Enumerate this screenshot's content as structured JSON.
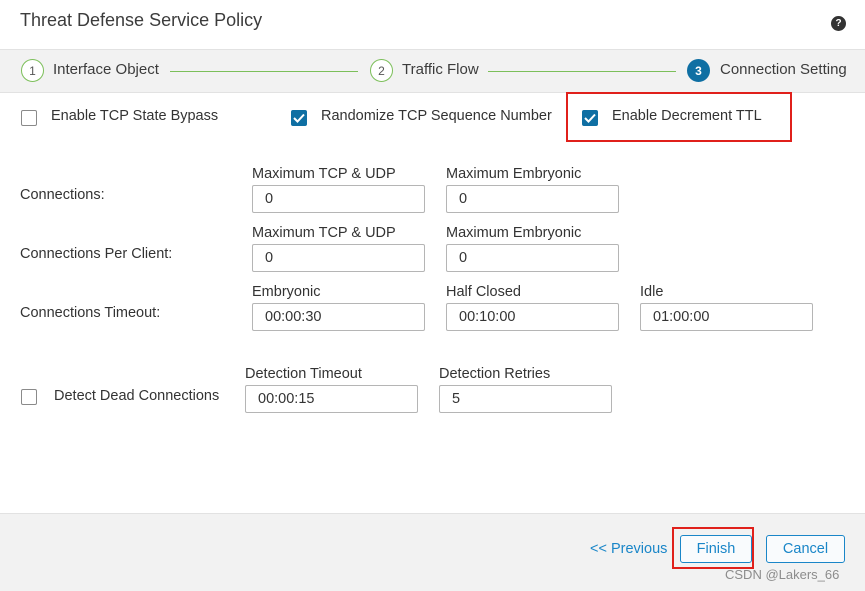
{
  "dialog": {
    "title": "Threat Defense Service Policy",
    "help_icon": "?"
  },
  "wizard": {
    "steps": [
      {
        "number": "1",
        "label": "Interface Object",
        "state": "done"
      },
      {
        "number": "2",
        "label": "Traffic Flow",
        "state": "done"
      },
      {
        "number": "3",
        "label": "Connection Setting",
        "state": "active"
      }
    ]
  },
  "options": {
    "tcp_state_bypass": {
      "label": "Enable TCP State Bypass",
      "checked": false
    },
    "randomize_tcp": {
      "label": "Randomize TCP Sequence Number",
      "checked": true
    },
    "decrement_ttl": {
      "label": "Enable Decrement TTL",
      "checked": true
    }
  },
  "connections": {
    "label": "Connections:",
    "max_label": "Maximum TCP & UDP",
    "max_value": "0",
    "embryonic_label": "Maximum Embryonic",
    "embryonic_value": "0"
  },
  "per_client": {
    "label": "Connections Per Client:",
    "max_label": "Maximum TCP & UDP",
    "max_value": "0",
    "embryonic_label": "Maximum Embryonic",
    "embryonic_value": "0"
  },
  "timeout": {
    "label": "Connections Timeout:",
    "embryonic_label": "Embryonic",
    "embryonic_value": "00:00:30",
    "half_closed_label": "Half Closed",
    "half_closed_value": "00:10:00",
    "idle_label": "Idle",
    "idle_value": "01:00:00"
  },
  "dead_connections": {
    "label": "Detect Dead Connections",
    "checked": false,
    "timeout_label": "Detection Timeout",
    "timeout_value": "00:00:15",
    "retries_label": "Detection Retries",
    "retries_value": "5"
  },
  "footer": {
    "previous_label": "<< Previous",
    "finish_label": "Finish",
    "cancel_label": "Cancel",
    "watermark": "CSDN @Lakers_66"
  },
  "colors": {
    "accent": "#0f6fa3",
    "link": "#1a86c8",
    "wizard_line": "#7cbf5a",
    "highlight_box": "#e0201b"
  }
}
